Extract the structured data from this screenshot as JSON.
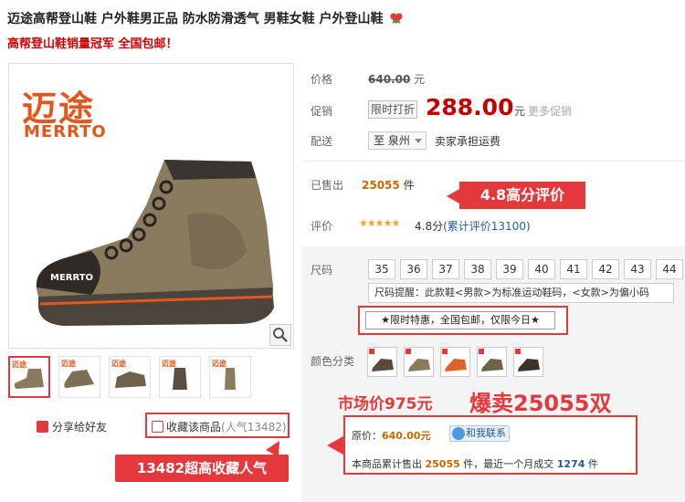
{
  "header": {
    "title": "迈途高帮登山鞋 户外鞋男正品 防水防滑透气 男鞋女鞋 户外登山鞋",
    "subtitle": "高帮登山鞋销量冠军 全国包邮！"
  },
  "gallery": {
    "brand_cn": "迈途",
    "brand_en": "MERRTO",
    "thumb_count": 5,
    "active_thumb": 0
  },
  "social": {
    "share_label": "分享给好友",
    "favorite_label": "收藏该商品",
    "favorite_count": "(人气13482)",
    "favorite_badge": "13482超高收藏人气"
  },
  "pricing": {
    "price_label": "价格",
    "original_price": "640.00",
    "currency_unit": "元",
    "promo_label": "促销",
    "promo_tag": "限时打折",
    "sale_price": "288.00",
    "more_promos": "更多促销"
  },
  "shipping": {
    "label": "配送",
    "destination": "至 泉州",
    "note": "卖家承担运费"
  },
  "sales": {
    "label": "已售出",
    "count": "25055",
    "unit": "件",
    "rating_badge": "4.8高分评价"
  },
  "review": {
    "label": "评价",
    "stars": "★★★★★",
    "score": "4.8分",
    "total": "(累计评价13100)"
  },
  "sku": {
    "size_label": "尺码",
    "sizes": [
      "35",
      "36",
      "37",
      "38",
      "39",
      "40",
      "41",
      "42",
      "43",
      "44"
    ],
    "size_tip": "尺码提醒：此款鞋<男款>为标准运动鞋码，<女款>为偏小码",
    "promo_banner": "★限时特惠，全国包邮，仅限今日★",
    "color_label": "颜色分类",
    "colors": [
      "dark-brown",
      "khaki",
      "orange",
      "olive",
      "black-brown"
    ]
  },
  "overlay": {
    "market_price": "市场价975元",
    "hot_sale": "爆卖25055双",
    "original_price_label": "原价：",
    "original_price_value": "640.00元",
    "contact_label": "和我联系",
    "sales_prefix": "本商品累计售出",
    "sales_total": "25055",
    "sales_unit": "件",
    "sales_mid": "，最近一个月成交",
    "sales_month": "1274",
    "sales_suffix": "件"
  },
  "colors": {
    "accent": "#e4393c",
    "price": "#c40000",
    "brand": "#e0581e",
    "link": "#225c9c"
  }
}
